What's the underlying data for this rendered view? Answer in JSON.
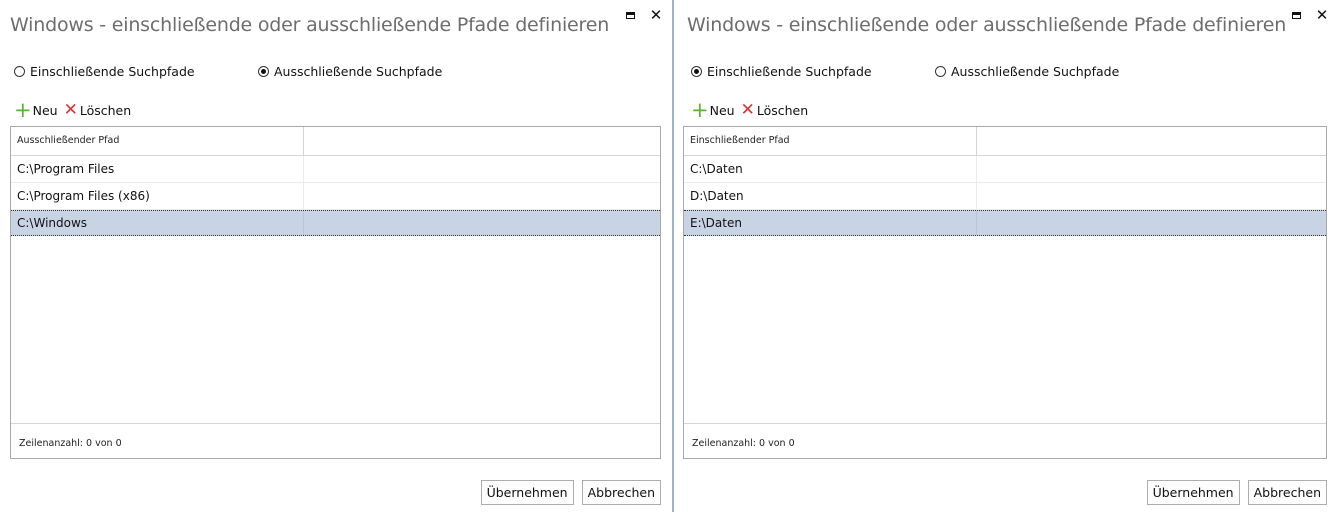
{
  "left": {
    "title": "Windows - einschließende oder ausschließende Pfade definieren",
    "radio_include": "Einschließende Suchpfade",
    "radio_exclude": "Ausschließende Suchpfade",
    "selected_radio": "exclude",
    "toolbar": {
      "new": "Neu",
      "delete": "Löschen"
    },
    "column_header": "Ausschließender Pfad",
    "rows": [
      "C:\\Program Files",
      "C:\\Program Files (x86)",
      "C:\\Windows"
    ],
    "selected_row": 2,
    "row_count": "Zeilenanzahl: 0 von 0",
    "apply": "Übernehmen",
    "cancel": "Abbrechen"
  },
  "right": {
    "title": "Windows - einschließende oder ausschließende Pfade definieren",
    "radio_include": "Einschließende Suchpfade",
    "radio_exclude": "Ausschließende Suchpfade",
    "selected_radio": "include",
    "toolbar": {
      "new": "Neu",
      "delete": "Löschen"
    },
    "column_header": "Einschließender Pfad",
    "rows": [
      "C:\\Daten",
      "D:\\Daten",
      "E:\\Daten"
    ],
    "selected_row": 2,
    "row_count": "Zeilenanzahl: 0 von 0",
    "apply": "Übernehmen",
    "cancel": "Abbrechen"
  },
  "icons": {
    "maximize": "maximize-icon",
    "close": "close-icon",
    "new": "plus-icon",
    "delete": "cross-icon"
  },
  "colors": {
    "title": "#6d6d6d",
    "selection": "#c8d4e4",
    "plus": "#5bb133",
    "cross": "#e03030"
  }
}
